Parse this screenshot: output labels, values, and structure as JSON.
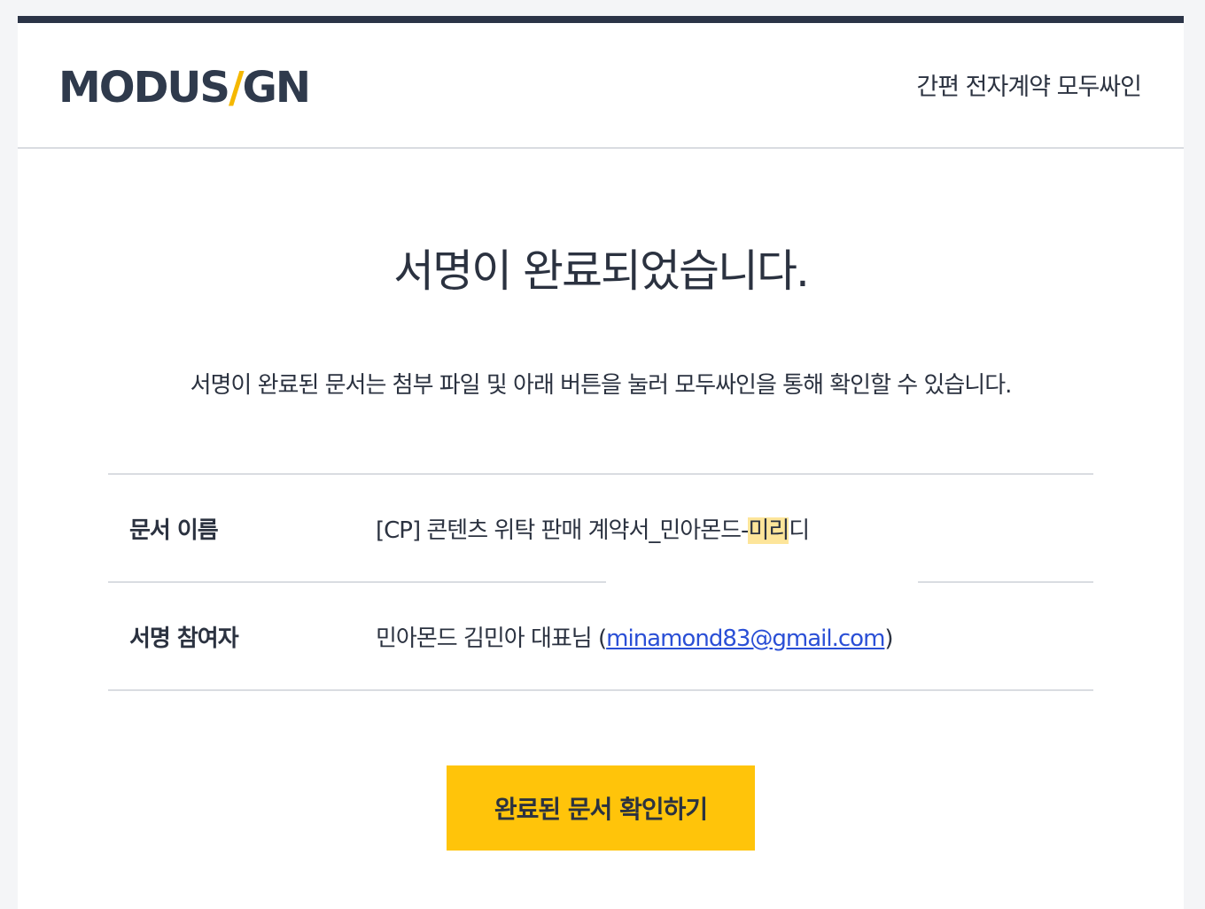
{
  "header": {
    "logo_left": "MODUS",
    "logo_slash": "/",
    "logo_right": "GN",
    "tagline": "간편 전자계약 모두싸인"
  },
  "main": {
    "title": "서명이 완료되었습니다.",
    "description": "서명이 완료된 문서는 첨부 파일 및 아래 버튼을 눌러 모두싸인을 통해 확인할 수 있습니다."
  },
  "info": {
    "document_label": "문서 이름",
    "document_name_prefix": "[CP] 콘텐츠 위탁 판매 계약서_민아몬드-",
    "document_name_highlight": "미리",
    "document_name_suffix": "디",
    "participant_label": "서명 참여자",
    "participant_name": "민아몬드 김민아 대표님 (",
    "participant_email": "minamond83@gmail.com",
    "participant_close": ")"
  },
  "button": {
    "label": "완료된 문서 확인하기"
  },
  "colors": {
    "accent": "#ffc40a",
    "top_bar": "#2b3447",
    "text": "#2b3240",
    "highlight": "#fde59a",
    "link": "#2a4fd6"
  }
}
